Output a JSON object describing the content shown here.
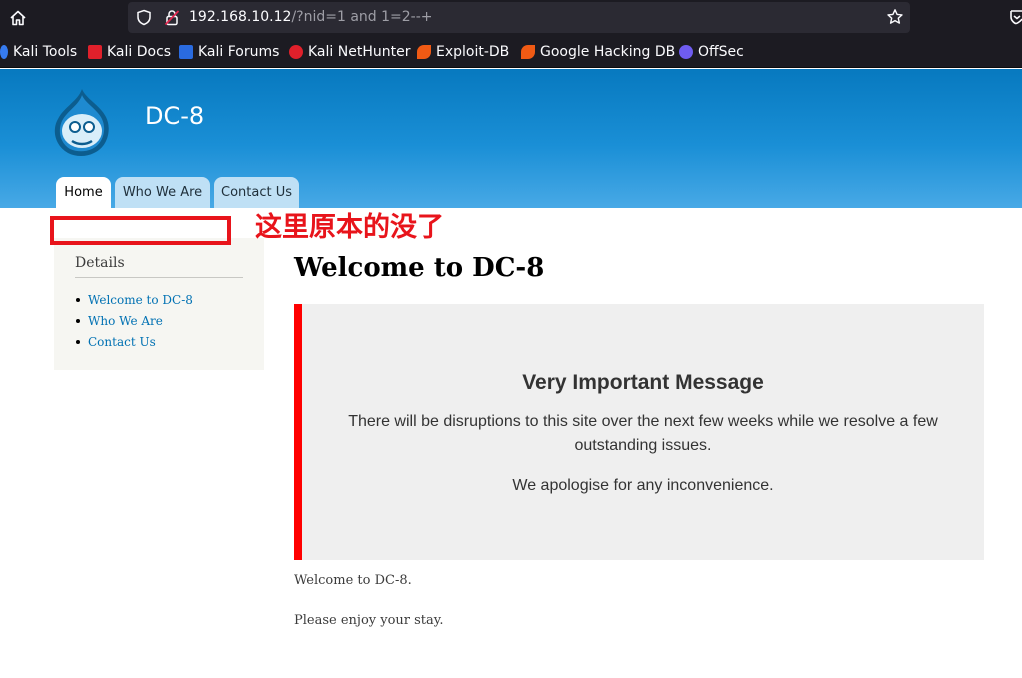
{
  "browser": {
    "url_host": "192.168.10.12",
    "url_path": "/?nid=1 and 1=2--+",
    "bookmarks": [
      {
        "label": "Kali Tools",
        "icon": "kali-tools-icon",
        "color": "#367bf0"
      },
      {
        "label": "Kali Docs",
        "icon": "kali-docs-icon",
        "color": "#e0202b"
      },
      {
        "label": "Kali Forums",
        "icon": "kali-forums-icon",
        "color": "#2a6be0"
      },
      {
        "label": "Kali NetHunter",
        "icon": "kali-nethunter-icon",
        "color": "#e0202b"
      },
      {
        "label": "Exploit-DB",
        "icon": "exploit-db-icon",
        "color": "#f05a14"
      },
      {
        "label": "Google Hacking DB",
        "icon": "ghdb-icon",
        "color": "#f05a14"
      },
      {
        "label": "OffSec",
        "icon": "offsec-icon",
        "color": "#6f5cf0"
      }
    ]
  },
  "site": {
    "name": "DC-8",
    "logo": "drupal-drop-logo",
    "header_color": "#0779bf",
    "tabs": [
      {
        "label": "Home",
        "active": true
      },
      {
        "label": "Who We Are",
        "active": false
      },
      {
        "label": "Contact Us",
        "active": false
      }
    ]
  },
  "annotation": {
    "text": "这里原本的没了",
    "color": "#e8141b"
  },
  "sidebar": {
    "title": "Details",
    "links": [
      "Welcome to DC-8",
      "Who We Are",
      "Contact Us"
    ]
  },
  "main": {
    "title": "Welcome to DC-8",
    "notice": {
      "title": "Very Important Message",
      "body": "There will be disruptions to this site over the next few weeks while we resolve a few outstanding issues.",
      "apology": "We apologise for any inconvenience.",
      "accent_color": "#ff0000"
    },
    "paragraphs": [
      "Welcome to DC-8.",
      "Please enjoy your stay."
    ]
  }
}
